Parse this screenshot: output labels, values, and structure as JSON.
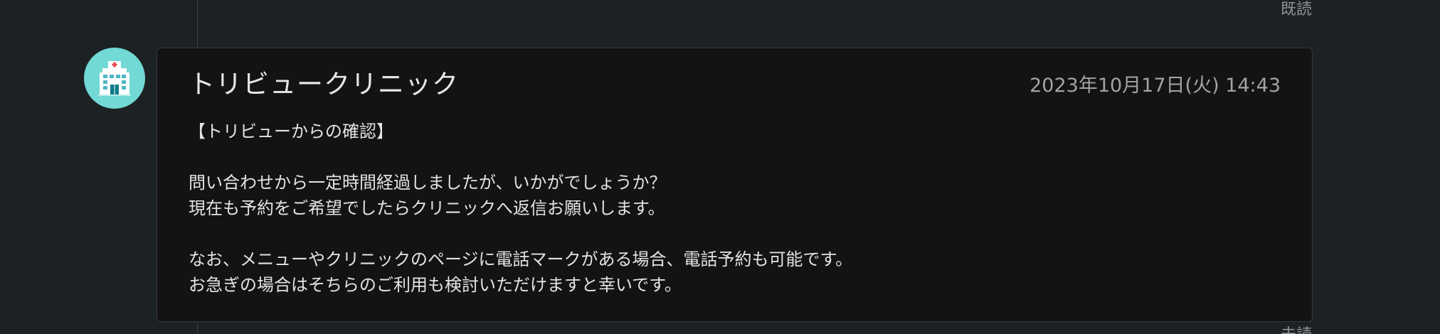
{
  "thread": {
    "read_status_top": "既読",
    "read_status_bottom": "未読"
  },
  "message": {
    "avatar_icon": "hospital-icon",
    "sender": "トリビュークリニック",
    "timestamp": "2023年10月17日(火) 14:43",
    "lines": [
      "【トリビューからの確認】",
      "",
      "問い合わせから一定時間経過しましたが、いかがでしょうか？",
      "現在も予約をご希望でしたらクリニックへ返信お願いします。",
      "",
      "なお、メニューやクリニックのページに電話マークがある場合、電話予約も可能です。",
      "お急ぎの場合はそちらのご利用も検討いただけますと幸いです。"
    ]
  },
  "colors": {
    "background": "#1c2123",
    "card": "#131313",
    "avatar": "#72d9d5"
  }
}
